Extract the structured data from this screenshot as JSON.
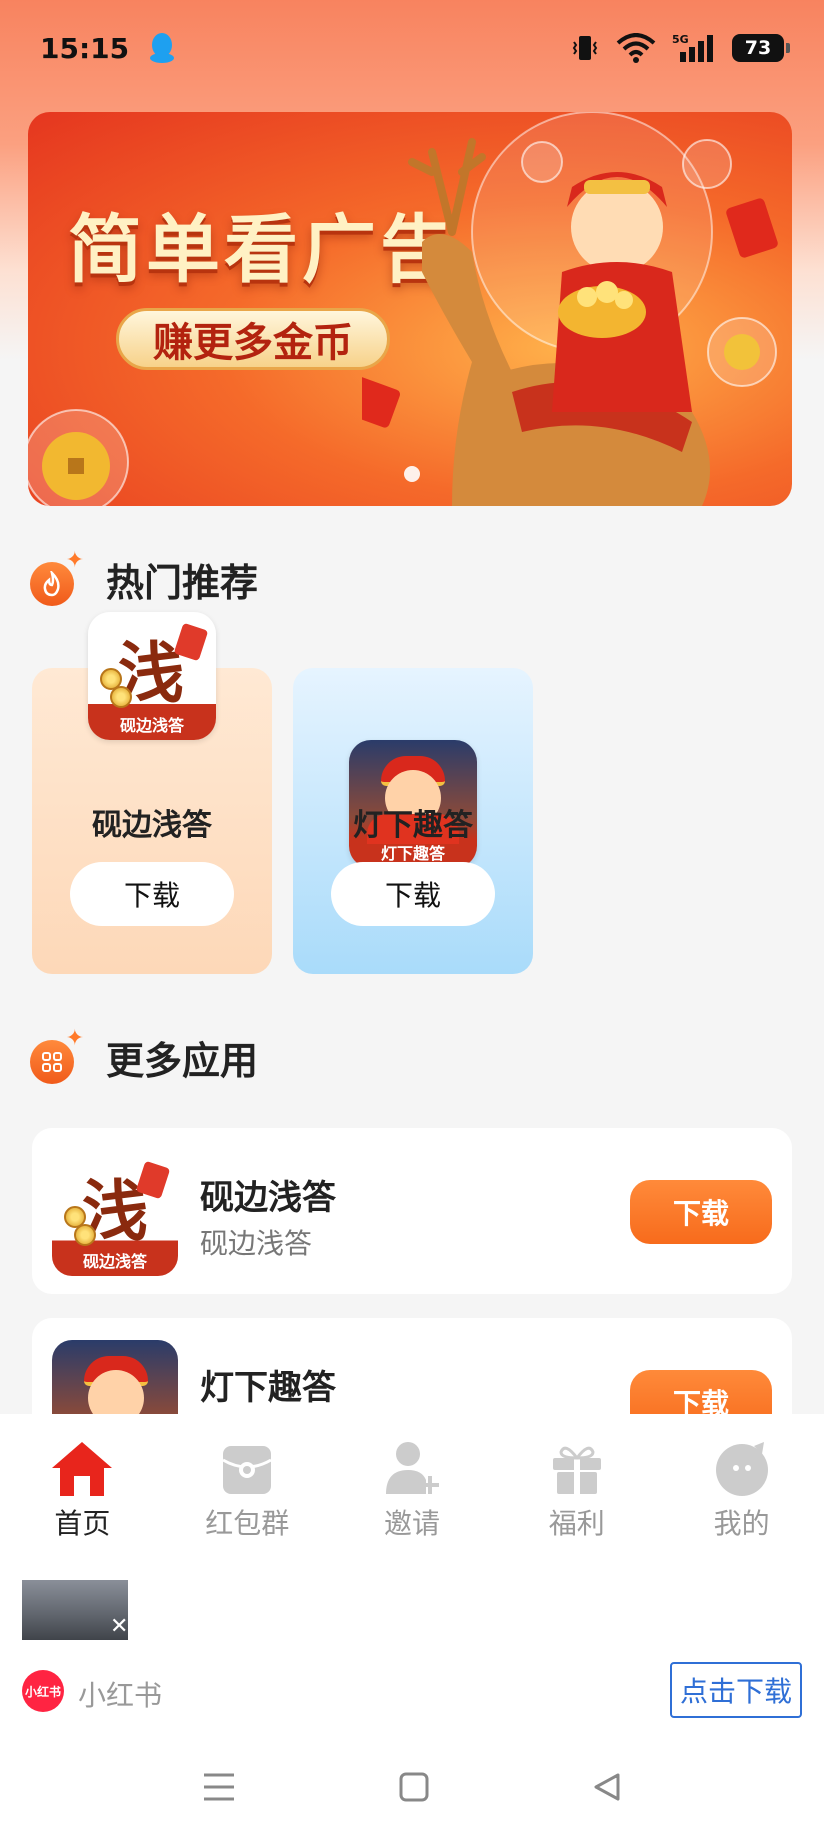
{
  "status_bar": {
    "time": "15:15",
    "battery": "73",
    "network": "5G"
  },
  "banner": {
    "title": "简单看广告",
    "subtitle": "赚更多金币"
  },
  "hot_section": {
    "title": "热门推荐",
    "cards": [
      {
        "name": "砚边浅答",
        "icon_caption": "砚边浅答",
        "icon_glyph": "浅",
        "button": "下载"
      },
      {
        "name": "灯下趣答",
        "icon_caption": "灯下趣答",
        "button": "下载"
      }
    ]
  },
  "more_section": {
    "title": "更多应用",
    "items": [
      {
        "name": "砚边浅答",
        "desc": "砚边浅答",
        "icon_caption": "砚边浅答",
        "icon_glyph": "浅",
        "button": "下载"
      },
      {
        "name": "灯下趣答",
        "desc": "",
        "icon_caption": "",
        "button": "下载"
      }
    ]
  },
  "bottom_nav": [
    {
      "label": "首页",
      "icon": "home-icon",
      "active": true
    },
    {
      "label": "红包群",
      "icon": "red-packet-icon",
      "active": false
    },
    {
      "label": "邀请",
      "icon": "invite-icon",
      "active": false
    },
    {
      "label": "福利",
      "icon": "gift-icon",
      "active": false
    },
    {
      "label": "我的",
      "icon": "profile-icon",
      "active": false
    }
  ],
  "ad": {
    "logo_text": "小红书",
    "app_name": "小红书",
    "button": "点击下载"
  },
  "colors": {
    "accent": "#f76b1c",
    "nav_active": "#e8251c",
    "link_blue": "#2f6fd6"
  }
}
